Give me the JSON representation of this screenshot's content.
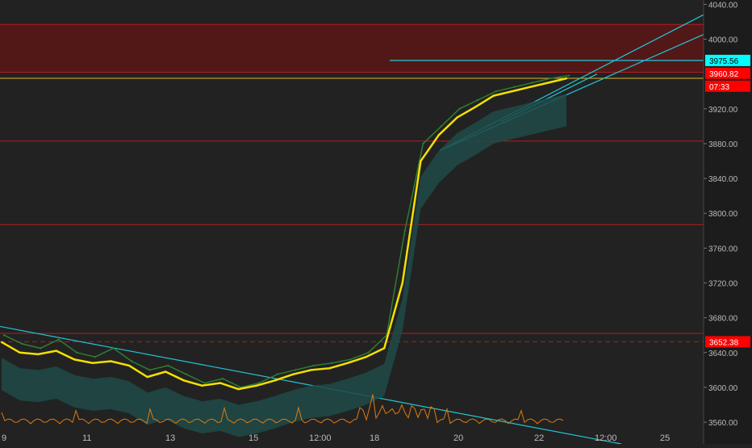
{
  "chart_data": {
    "type": "line",
    "title": "",
    "xlabel": "",
    "ylabel": "",
    "ylim": [
      3535,
      4045
    ],
    "y_ticks": [
      "3560.00",
      "3600.00",
      "3640.00",
      "3680.00",
      "3720.00",
      "3760.00",
      "3800.00",
      "3840.00",
      "3880.00",
      "3920.00",
      "4000.00",
      "4040.00"
    ],
    "x_ticks": [
      "9",
      "11",
      "13",
      "15",
      "12:00",
      "18",
      "20",
      "22",
      "12:00",
      "25"
    ],
    "grid": false,
    "price_labels": [
      {
        "text": "3975.56",
        "value": 3975.56,
        "color": "#00ffff",
        "text_color": "#000000"
      },
      {
        "text": "3960.82",
        "value": 3960.82,
        "color": "#ff0000",
        "text_color": "#ffffff"
      },
      {
        "text": "07:33",
        "value": 3946,
        "color": "#ff0000",
        "text_color": "#ffffff"
      },
      {
        "text": "3652.38",
        "value": 3652.38,
        "color": "#ff0000",
        "text_color": "#ffffff"
      }
    ],
    "resistance_zone": [
      3962,
      4017
    ],
    "horizontal_levels": [
      3962,
      3955,
      3883,
      3787,
      3662,
      3652.38,
      4017
    ],
    "level_colors": {
      "red": "#b71c1c",
      "gold": "#e6b422",
      "cyan": "#22c7d6",
      "price": "#f5e000",
      "trend": "#2e7d32",
      "volume": "#e07a10"
    },
    "series": [
      {
        "values": [
          3660,
          3650,
          3645,
          3655,
          3640,
          3635,
          3645,
          3630,
          3620,
          3625,
          3615,
          3605,
          3610,
          3600,
          3605,
          3615,
          3620,
          3625,
          3628,
          3632,
          3640,
          3660,
          3780,
          3880,
          3900,
          3920,
          3930,
          3940,
          3945,
          3950,
          3955,
          3958
        ]
      },
      {
        "values": [
          3652,
          3640,
          3638,
          3642,
          3632,
          3628,
          3630,
          3625,
          3612,
          3618,
          3608,
          3602,
          3605,
          3598,
          3602,
          3608,
          3615,
          3620,
          3622,
          3628,
          3635,
          3645,
          3720,
          3860,
          3890,
          3910,
          3922,
          3935,
          3940,
          3945,
          3950,
          3955
        ]
      }
    ]
  }
}
